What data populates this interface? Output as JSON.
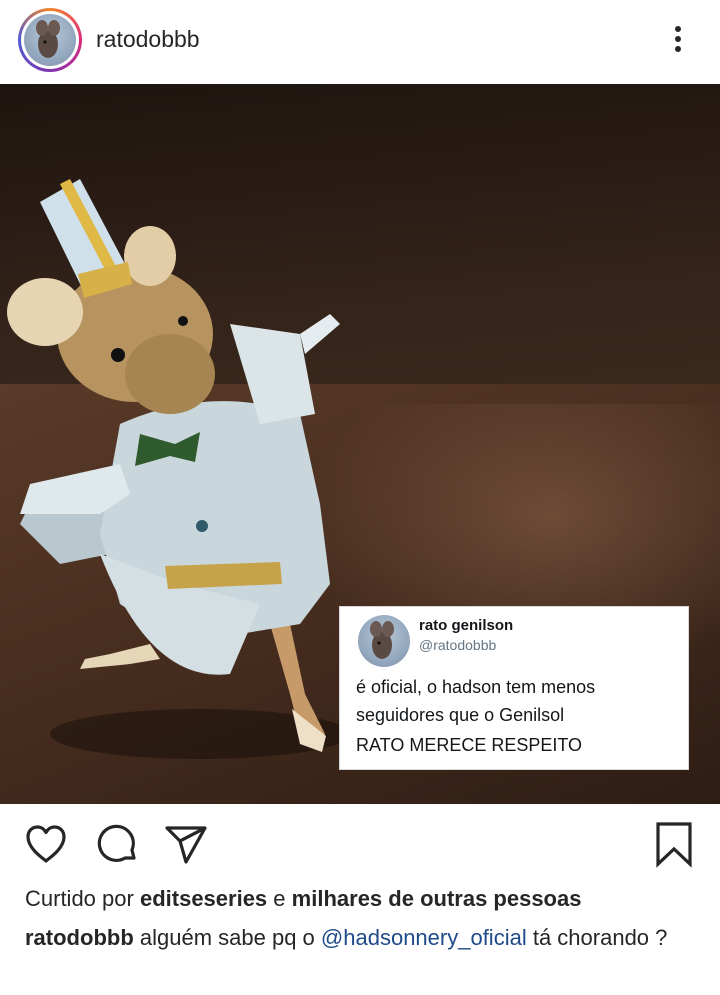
{
  "header": {
    "username": "ratodobbb",
    "avatar_icon": "mouse-avatar-icon",
    "more_icon": "more-vertical-icon"
  },
  "post": {
    "image_alt_icon": "dancing-mouse-photo",
    "tweet": {
      "name": "rato genilson",
      "handle": "@ratodobbb",
      "text_line1": "é oficial, o hadson tem menos",
      "text_line2": "seguidores que o Genilsol",
      "text_line3": "RATO MERECE RESPEITO"
    }
  },
  "actions": {
    "like_icon": "heart-icon",
    "comment_icon": "comment-icon",
    "share_icon": "send-icon",
    "save_icon": "bookmark-icon"
  },
  "likes": {
    "prefix": "Curtido por",
    "user": "editseseries",
    "connector": "e",
    "others": "milhares de outras pessoas"
  },
  "caption": {
    "username": "ratodobbb",
    "text_before": "alguém sabe pq o",
    "mention": "@hadsonnery_oficial",
    "text_after": "tá chorando ?"
  },
  "colors": {
    "text": "#262626",
    "mention": "#1f4a8a",
    "tweet_handle": "#657786"
  }
}
